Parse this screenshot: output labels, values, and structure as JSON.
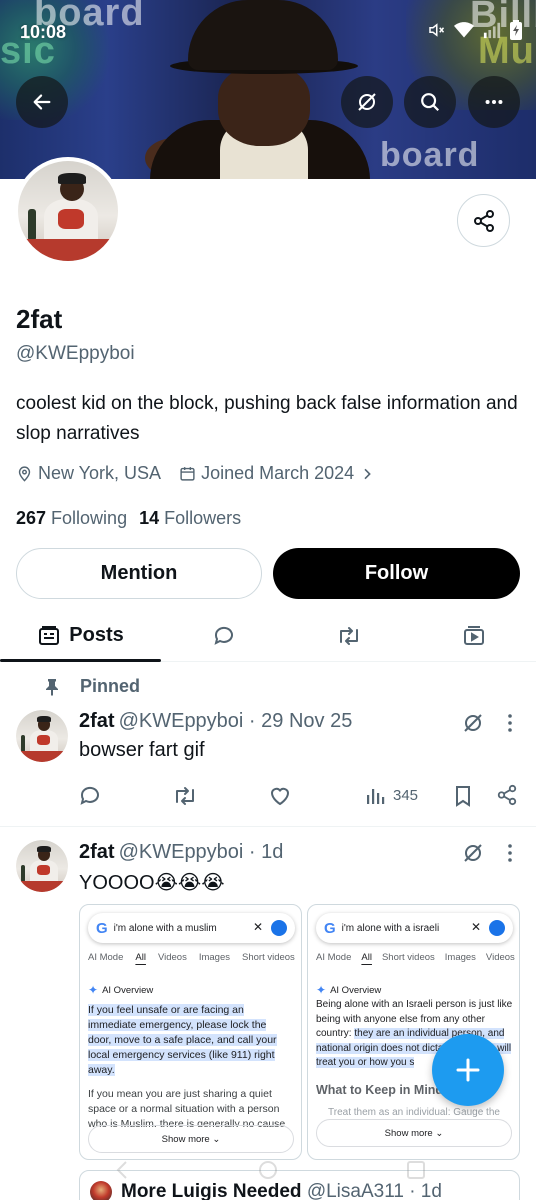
{
  "status_bar": {
    "time": "10:08"
  },
  "header": {
    "banner_texts": [
      "board",
      "sic",
      "Billbo",
      "Mus",
      "board"
    ]
  },
  "profile": {
    "name": "2fat",
    "handle": "@KWEppyboi",
    "bio": "coolest kid on the block, pushing back false information and slop narratives",
    "location": "New York, USA",
    "joined": "Joined March 2024",
    "following_count": "267",
    "following_label": "Following",
    "followers_count": "14",
    "followers_label": "Followers"
  },
  "buttons": {
    "mention": "Mention",
    "follow": "Follow"
  },
  "tabs": {
    "posts": "Posts"
  },
  "pinned_label": "Pinned",
  "posts": [
    {
      "author": "2fat",
      "meta": "@KWEppyboi · 29 Nov 25",
      "text": "bowser fart gif",
      "views": "345"
    },
    {
      "author": "2fat",
      "meta": "@KWEppyboi · 1d",
      "text": "YOOOO😭😭😭",
      "images": [
        {
          "query": "i'm alone with a muslim",
          "tabs": [
            "AI Mode",
            "All",
            "Videos",
            "Images",
            "Short videos"
          ],
          "ai_label": "AI Overview",
          "highlight": "If you feel unsafe or are facing an immediate emergency, please lock the door, move to a safe place, and call your local emergency services (like 911) right away.",
          "body": "If you mean you are just sharing a quiet space or a normal situation with a person who is Muslim, there is generally no cause",
          "show_more": "Show more ⌄"
        },
        {
          "query": "i'm alone with a israeli",
          "tabs": [
            "AI Mode",
            "All",
            "Short videos",
            "Images",
            "Videos"
          ],
          "ai_label": "AI Overview",
          "body": "Being alone with an Israeli person is just like being with anyone else from any other country:",
          "highlight": "they are an individual person, and national origin does not dictate how they will treat you or how you s",
          "heading": "What to Keep in Mind",
          "bullet": "Treat them as an individual: Gauge the",
          "show_more": "Show more ⌄"
        }
      ],
      "quote": {
        "author": "More Luigis Needed",
        "meta": "@LisaA311 · 1d"
      }
    }
  ],
  "colors": {
    "accent": "#1d9bf0",
    "text": "#0f1419",
    "muted": "#536471",
    "border": "#cfd9de"
  }
}
